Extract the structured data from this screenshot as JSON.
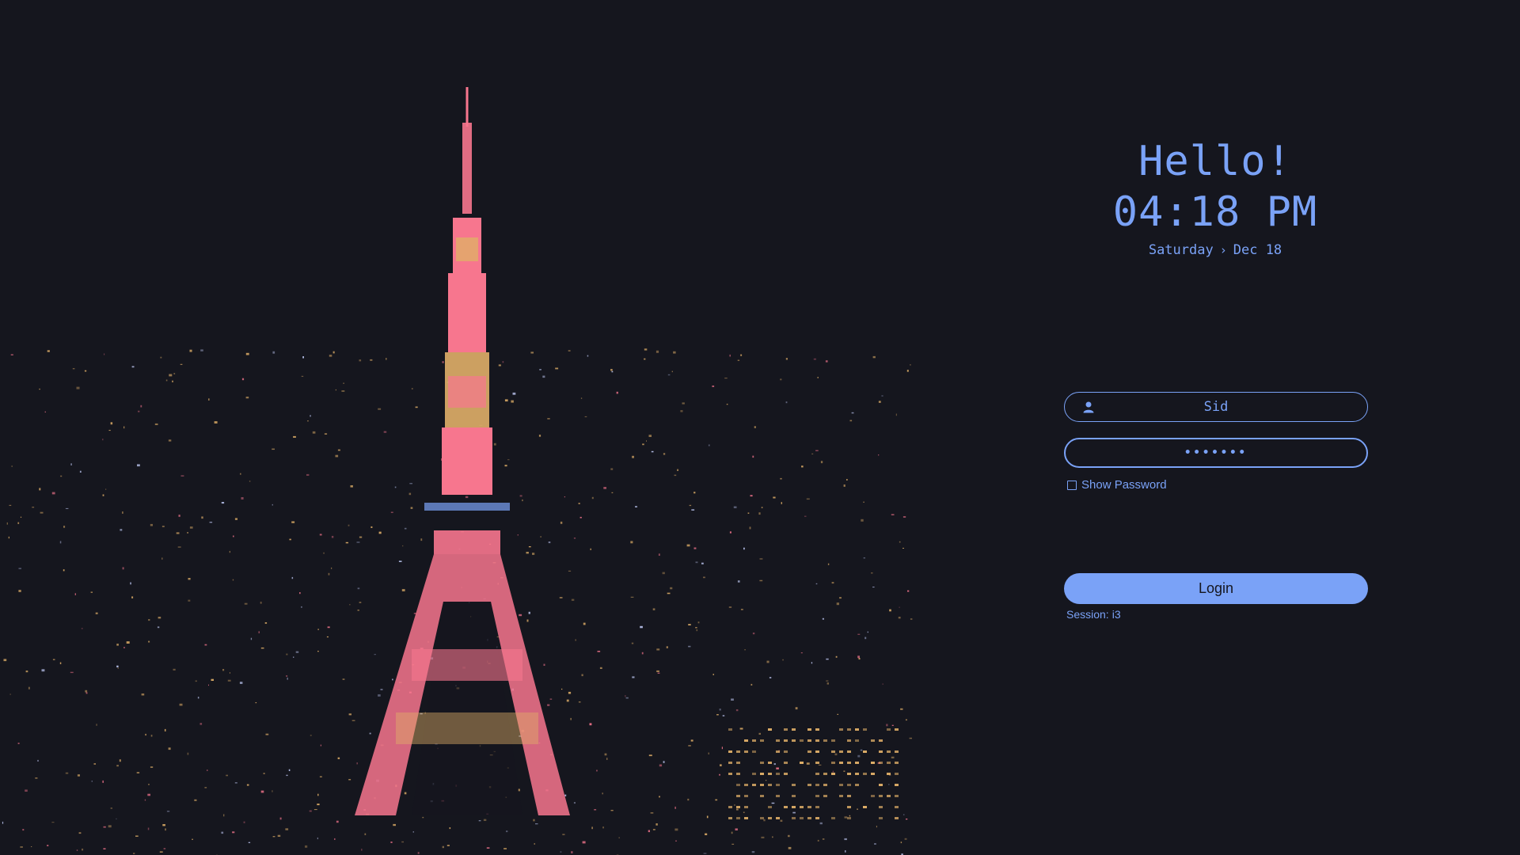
{
  "greeting": "Hello!",
  "clock": "04:18 PM",
  "date": {
    "day": "Saturday",
    "separator": "›",
    "date": "Dec 18"
  },
  "username_field": {
    "icon": "user-icon",
    "value": "Sid"
  },
  "password_field": {
    "value": "•••••••"
  },
  "show_password": {
    "label": "Show Password",
    "checked": false
  },
  "login_button": {
    "label": "Login"
  },
  "session": {
    "label": "Session:",
    "value": "i3"
  },
  "colors": {
    "background": "#15161e",
    "accent": "#7aa2f7",
    "tower": "#f7768e",
    "tower_highlight": "#e0af68",
    "city_lights": "#e0af68"
  },
  "wallpaper": {
    "subject": "tokyo-tower-night-city"
  }
}
